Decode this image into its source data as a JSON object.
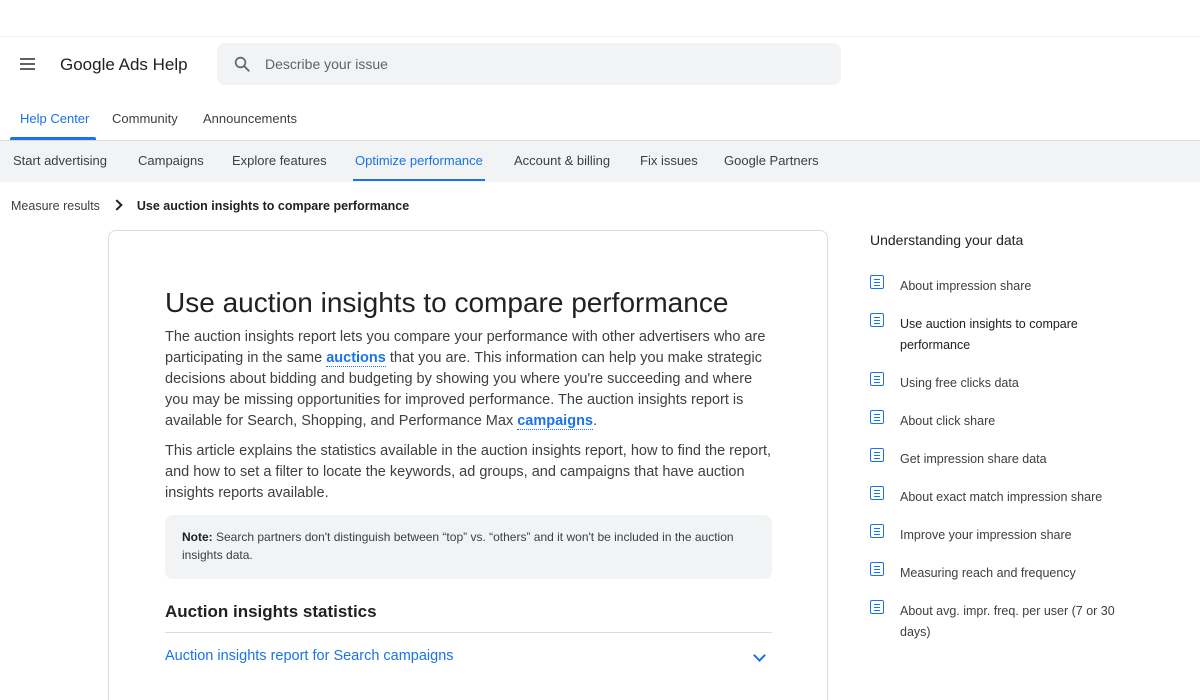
{
  "header": {
    "app_title": "Google Ads Help",
    "search_placeholder": "Describe your issue"
  },
  "top_tabs": [
    "Help Center",
    "Community",
    "Announcements"
  ],
  "subnav": [
    "Start advertising",
    "Campaigns",
    "Explore features",
    "Optimize performance",
    "Account & billing",
    "Fix issues",
    "Google Partners"
  ],
  "breadcrumb": {
    "parent": "Measure results",
    "current": "Use auction insights to compare performance"
  },
  "article": {
    "title": "Use auction insights to compare performance",
    "p1_a": "The auction insights report lets you compare your performance with other advertisers who are participating in the same ",
    "p1_link1": "auctions",
    "p1_b": " that you are. This information can help you make strategic decisions about bidding and budgeting by showing you where you're succeeding and where you may be missing opportunities for improved performance. The auction insights report is available for Search, Shopping, and Performance Max ",
    "p1_link2": "campaigns",
    "p1_c": ".",
    "p2": "This article explains the statistics available in the auction insights report, how to find the report, and how to set a filter to locate the keywords, ad groups, and campaigns that have auction insights reports available.",
    "note_label": "Note:",
    "note_text": " Search partners don't distinguish between “top” vs. “others” and it won't be included in the auction insights data.",
    "section_title": "Auction insights statistics",
    "accordion_label": "Auction insights report for Search campaigns"
  },
  "sidebar": {
    "title": "Understanding your data",
    "items": [
      "About impression share",
      "Use auction insights to compare performance",
      "Using free clicks data",
      "About click share",
      "Get impression share data",
      "About exact match impression share",
      "Improve your impression share",
      "Measuring reach and frequency",
      "About avg. impr. freq. per user (7 or 30 days)"
    ]
  },
  "colors": {
    "accent": "#1a73e8",
    "text": "#202124",
    "muted": "#3c4043",
    "surface": "#f1f3f4"
  }
}
